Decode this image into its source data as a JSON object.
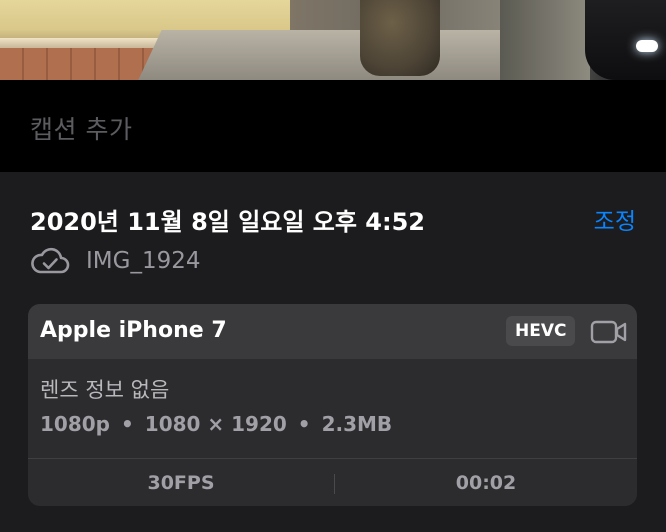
{
  "caption": {
    "placeholder": "캡션 추가"
  },
  "info": {
    "datetime": "2020년 11월 8일 일요일 오후 4:52",
    "adjust_label": "조정",
    "cloud_icon": "cloud-check-icon",
    "filename": "IMG_1924"
  },
  "device_card": {
    "device_name": "Apple iPhone 7",
    "codec_badge": "HEVC",
    "video_icon": "video-camera-icon",
    "lens_info": "렌즈 정보 없음",
    "resolution": "1080p",
    "dimensions": "1080 × 1920",
    "file_size": "2.3MB",
    "separator": "•",
    "fps": "30FPS",
    "duration": "00:02"
  },
  "colors": {
    "accent": "#0a84ff",
    "sheet_background": "#1c1c1e",
    "card_background": "#2c2c2e",
    "card_header": "#3a3a3c"
  }
}
